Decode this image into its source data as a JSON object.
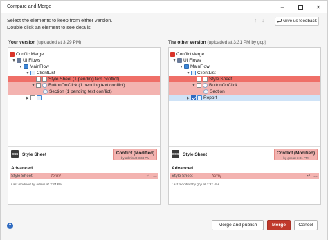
{
  "window": {
    "title": "Compare and Merge"
  },
  "instructions": {
    "line1": "Select the elements to keep from either version.",
    "line2": "Double click an element to see details."
  },
  "feedback": {
    "label": "Give us feedback",
    "icon": "chat-icon"
  },
  "left": {
    "header_bold": "Your version",
    "header_sub": "(uploaded at 3:29 PM)",
    "tree": {
      "app": "ConflictMerge",
      "ui_flows": "UI Flows",
      "main_flow": "MainFlow",
      "client_list": "ClientList",
      "style_sheet": "Style Sheet (1 pending text conflict)",
      "button_onclick": "ButtonOnClick (1 pending text conflict)",
      "section": "Section (1 pending text conflict)",
      "extra": "--"
    },
    "detail": {
      "badge": "CSS",
      "title": "Style Sheet",
      "conflict_title": "Conflict (Modified)",
      "conflict_sub": "by admin at 3:34 PM",
      "advanced_label": "Advanced",
      "prop_name": "Style Sheet",
      "prop_value": "form{",
      "last_modified": "Last modified by admin at 3:34 PM"
    }
  },
  "right": {
    "header_bold": "The other version",
    "header_sub": "(uploaded at 3:31 PM by gcp)",
    "tree": {
      "app": "ConflictMerge",
      "ui_flows": "UI Flows",
      "main_flow": "MainFlow",
      "client_list": "ClientList",
      "style_sheet": "Style Sheet",
      "button_onclick": "ButtonOnClick",
      "section": "Section",
      "report": "Report"
    },
    "detail": {
      "badge": "CSS",
      "title": "Style Sheet",
      "conflict_title": "Conflict (Modified)",
      "conflict_sub": "by gcp at 3:31 PM",
      "advanced_label": "Advanced",
      "prop_name": "Style Sheet",
      "prop_value": "form{",
      "last_modified": "Last modified by gcp at 3:31 PM"
    }
  },
  "footer": {
    "help": "?",
    "merge_publish": "Merge and publish",
    "merge": "Merge",
    "cancel": "Cancel"
  },
  "colors": {
    "conflict_light": "#f3b3b0",
    "conflict_strong": "#ef6f68",
    "selected": "#cfe3f7",
    "primary": "#c0392b",
    "accent": "#2f6bc1"
  }
}
